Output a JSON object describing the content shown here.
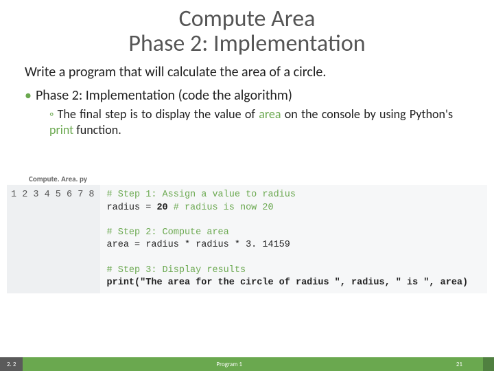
{
  "title": {
    "line1": "Compute Area",
    "line2": "Phase 2: Implementation"
  },
  "intro": "Write a program that will calculate the area of a circle.",
  "bullet1": "Phase 2: Implementation (code the algorithm)",
  "bullet2_pre": "The final step is to display the value of ",
  "bullet2_hl1": "area",
  "bullet2_mid": " on the console by using Python's ",
  "bullet2_hl2": "print",
  "bullet2_post": " function.",
  "filename": "Compute. Area. py",
  "gutter": "1\n2\n3\n4\n5\n6\n7\n8",
  "code": {
    "c1": "# Step 1: Assign a value to radius",
    "l2a": "radius = ",
    "l2b": "20",
    "l2c": " # radius is now 20",
    "c4": "# Step 2: Compute area",
    "l5": "area = radius * radius * 3. 14159",
    "c7": "# Step 3: Display results",
    "l8": "print(\"The area for the circle of radius \", radius, \" is \", area)"
  },
  "footer": {
    "section": "2. 2",
    "program": "Program 1",
    "page": "21"
  }
}
